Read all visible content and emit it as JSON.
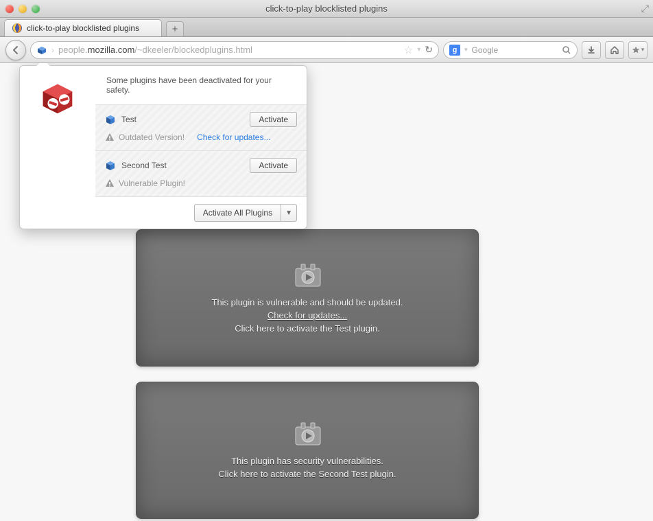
{
  "window": {
    "title": "click-to-play blocklisted plugins"
  },
  "tab": {
    "title": "click-to-play blocklisted plugins"
  },
  "url": {
    "prefix": "people.",
    "domain": "mozilla.com",
    "path": "/~dkeeler/blockedplugins.html"
  },
  "searchbox": {
    "engine_letter": "g",
    "placeholder": "Google"
  },
  "doorhanger": {
    "header": "Some plugins have been deactivated for your safety.",
    "plugins": [
      {
        "name": "Test",
        "activate_label": "Activate",
        "warning": "Outdated Version!",
        "update_link": "Check for updates..."
      },
      {
        "name": "Second Test",
        "activate_label": "Activate",
        "warning": "Vulnerable Plugin!",
        "update_link": ""
      }
    ],
    "activate_all_label": "Activate All Plugins"
  },
  "placeholders": [
    {
      "line1": "This plugin is vulnerable and should be updated.",
      "update_link": "Check for updates...",
      "line2": "Click here to activate the Test plugin."
    },
    {
      "line1": "This plugin has security vulnerabilities.",
      "update_link": "",
      "line2": "Click here to activate the Second Test plugin."
    }
  ]
}
